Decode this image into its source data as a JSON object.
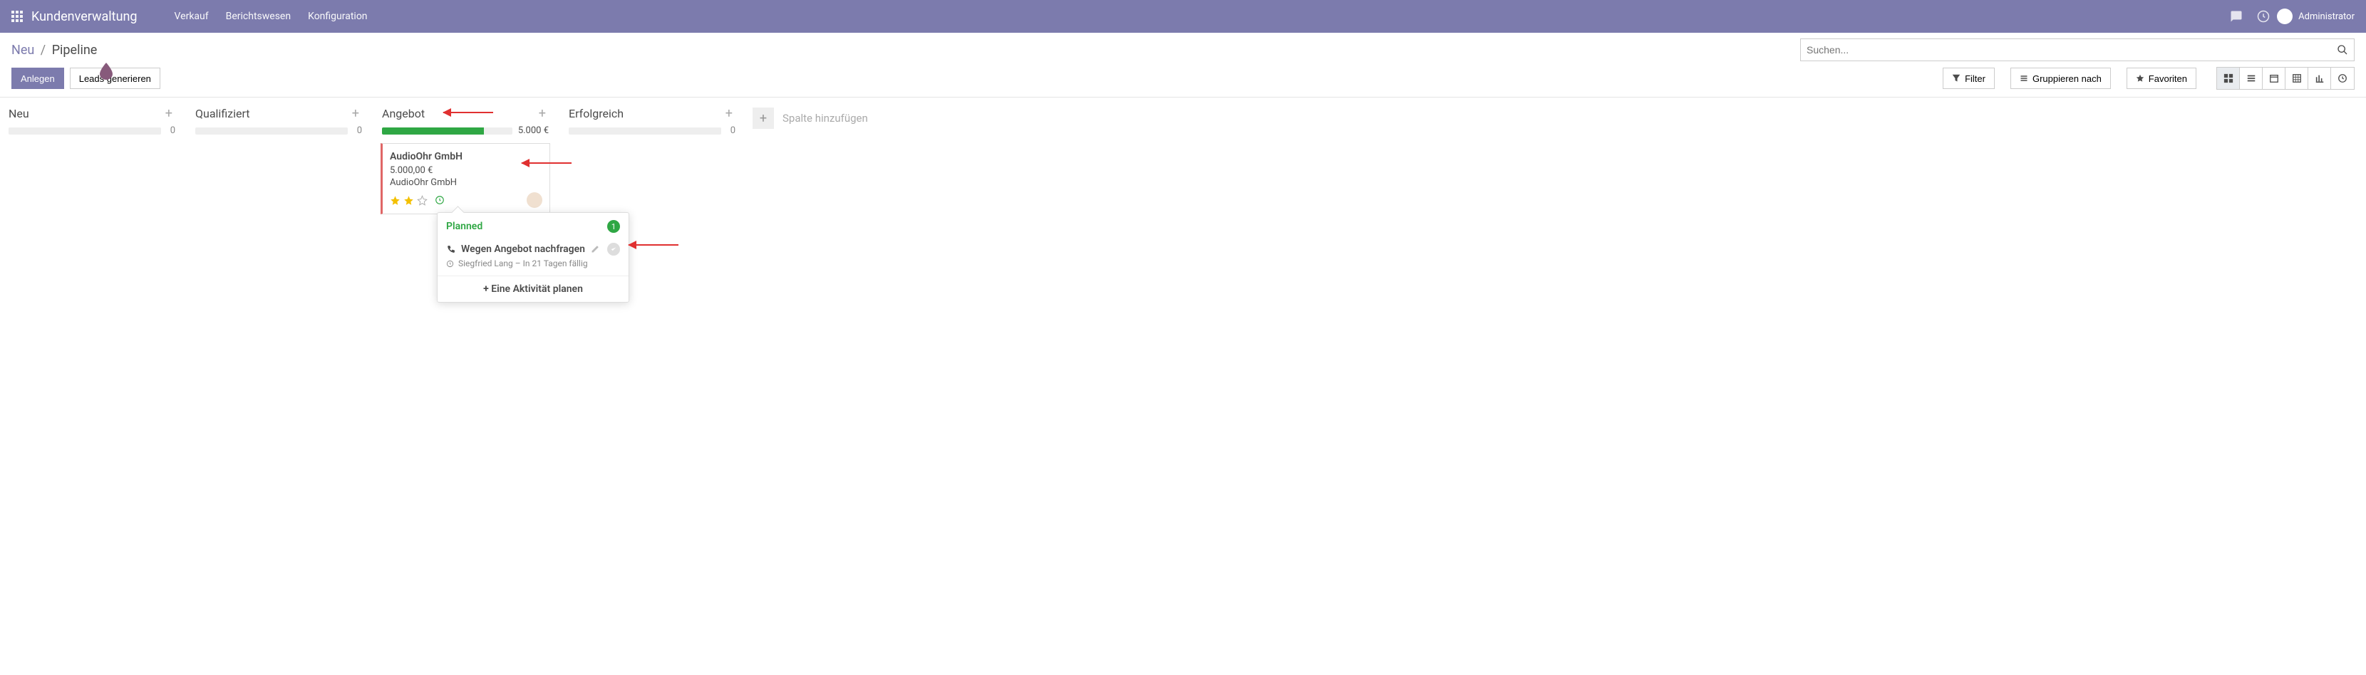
{
  "nav": {
    "app_title": "Kundenverwaltung",
    "menu": [
      "Verkauf",
      "Berichtswesen",
      "Konfiguration"
    ],
    "user_name": "Administrator"
  },
  "breadcrumb": {
    "parent": "Neu",
    "sep": "/",
    "current": "Pipeline"
  },
  "search": {
    "placeholder": "Suchen..."
  },
  "buttons": {
    "create": "Anlegen",
    "generate_leads": "Leads generieren",
    "filter": "Filter",
    "group_by": "Gruppieren nach",
    "favorites": "Favoriten"
  },
  "columns": [
    {
      "key": "neu",
      "title": "Neu",
      "amount": "",
      "count": "0",
      "fill_pct": 0
    },
    {
      "key": "qualifiziert",
      "title": "Qualifiziert",
      "amount": "",
      "count": "0",
      "fill_pct": 0
    },
    {
      "key": "angebot",
      "title": "Angebot",
      "amount": "5.000 €",
      "count": "",
      "fill_pct": 78
    },
    {
      "key": "erfolgreich",
      "title": "Erfolgreich",
      "amount": "",
      "count": "0",
      "fill_pct": 0
    }
  ],
  "add_column_label": "Spalte hinzufügen",
  "card": {
    "title": "AudioOhr GmbH",
    "amount": "5.000,00 €",
    "company": "AudioOhr GmbH",
    "stars_filled": 2,
    "stars_total": 3
  },
  "popover": {
    "section": "Planned",
    "badge": "1",
    "activity_icon": "phone",
    "activity_title": "Wegen Angebot nachfragen",
    "meta": "Siegfried Lang – In 21 Tagen fällig",
    "plan_activity": "Eine Aktivität planen"
  }
}
